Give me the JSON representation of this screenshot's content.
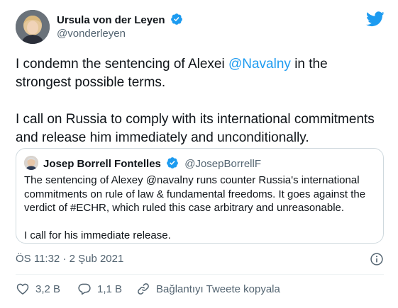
{
  "author": {
    "name": "Ursula von der Leyen",
    "handle": "@vonderleyen"
  },
  "tweet": {
    "line1_pre": "I condemn the sentencing of Alexei ",
    "line1_mention": "@Navalny",
    "line1_post": " in the strongest possible terms.",
    "line2": "I call on Russia to comply with its international commitments and release him immediately and unconditionally."
  },
  "quoted": {
    "name": "Josep Borrell Fontelles",
    "handle": "@JosepBorrellF",
    "text1": "The sentencing of Alexey @navalny runs counter Russia's international commitments on rule of law & fundamental freedoms. It goes against the verdict of #ECHR, which ruled this case arbitrary and unreasonable.",
    "text2": "I call for his immediate release."
  },
  "timestamp": "ÖS 11:32 · 2 Şub 2021",
  "actions": {
    "likes": "3,2 B",
    "replies": "1,1 B",
    "copy_link": "Bağlantıyı Tweete kopyala"
  },
  "colors": {
    "accent": "#1d9bf0",
    "text": "#0f1419",
    "muted": "#536471",
    "border": "#cfd9de"
  },
  "icons": [
    "twitter-bird-icon",
    "verified-badge-icon",
    "info-icon",
    "heart-icon",
    "reply-icon",
    "link-icon"
  ]
}
